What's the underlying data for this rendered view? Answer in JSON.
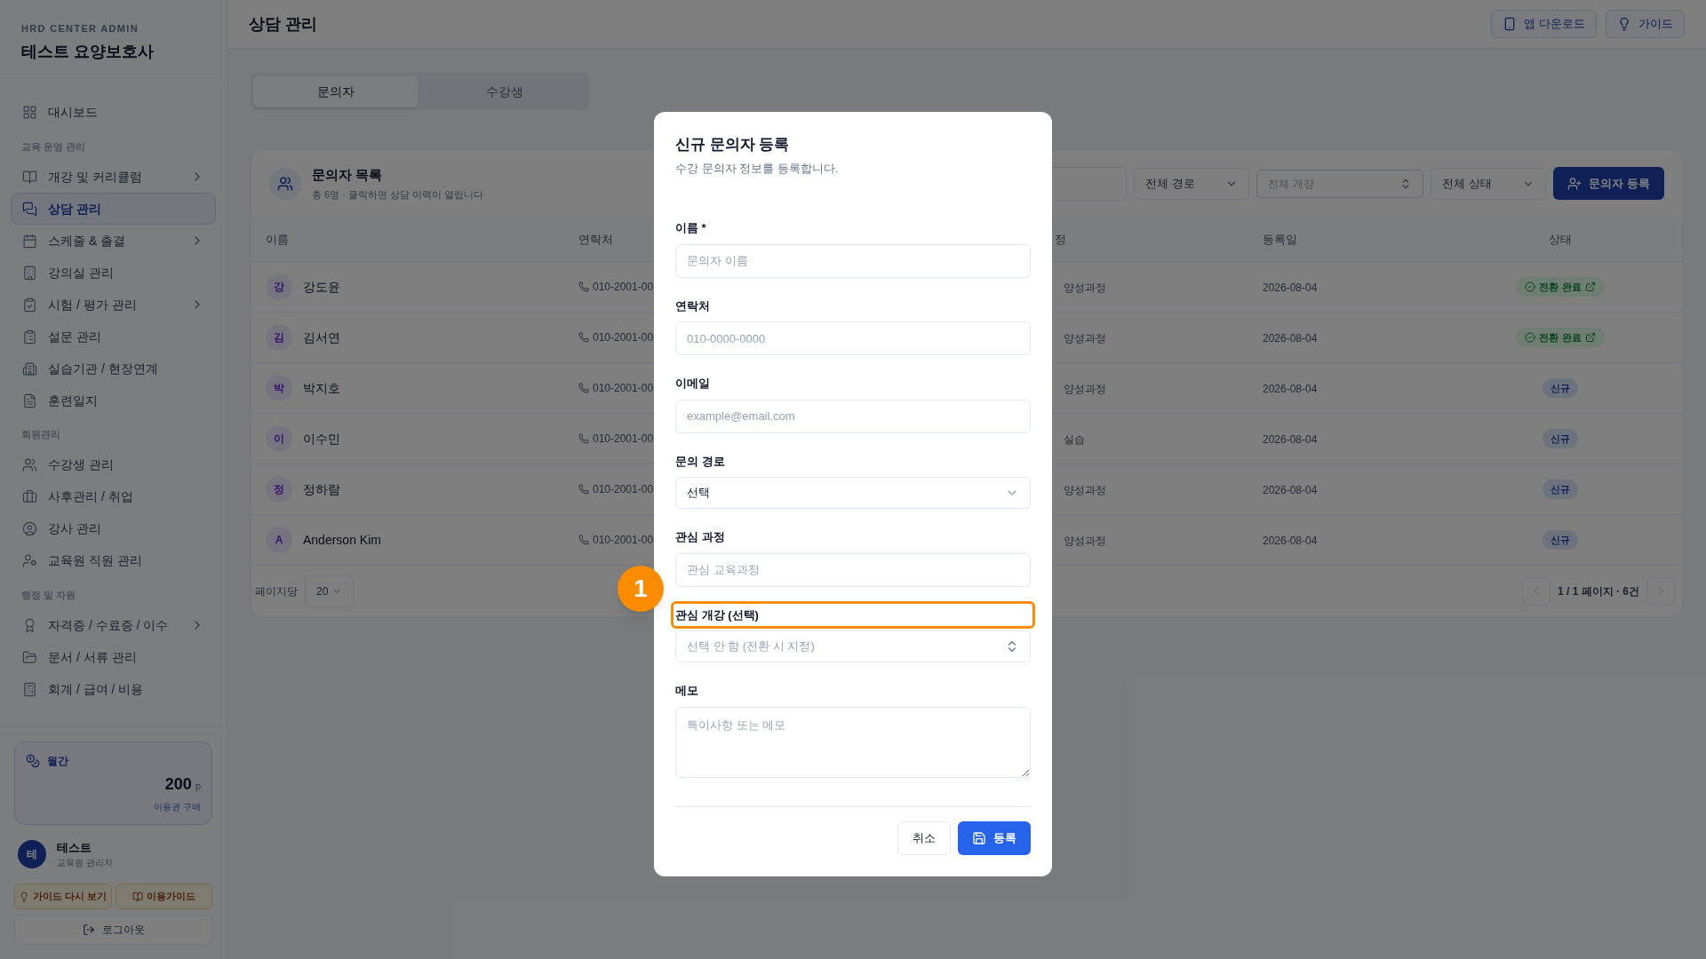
{
  "sidebar": {
    "eyebrow": "HRD CENTER ADMIN",
    "title": "테스트 요양보호사",
    "sections": [
      {
        "items": [
          {
            "label": "대시보드",
            "selected": false,
            "has_submenu": false
          }
        ]
      },
      {
        "label": "교육 운영 관리",
        "items": [
          {
            "label": "개강 및 커리큘럼",
            "selected": false,
            "has_submenu": true
          },
          {
            "label": "상담 관리",
            "selected": true,
            "has_submenu": false
          },
          {
            "label": "스케줄 & 출결",
            "selected": false,
            "has_submenu": true
          },
          {
            "label": "강의실 관리",
            "selected": false,
            "has_submenu": false
          },
          {
            "label": "시험 / 평가 관리",
            "selected": false,
            "has_submenu": true
          },
          {
            "label": "설문 관리",
            "selected": false,
            "has_submenu": false
          },
          {
            "label": "실습기관 / 현장연계",
            "selected": false,
            "has_submenu": false
          },
          {
            "label": "훈련일지",
            "selected": false,
            "has_submenu": false
          }
        ]
      },
      {
        "label": "회원관리",
        "items": [
          {
            "label": "수강생 관리",
            "selected": false,
            "has_submenu": false
          },
          {
            "label": "사후관리 / 취업",
            "selected": false,
            "has_submenu": false
          },
          {
            "label": "강사 관리",
            "selected": false,
            "has_submenu": false
          },
          {
            "label": "교육원 직원 관리",
            "selected": false,
            "has_submenu": false
          }
        ]
      },
      {
        "label": "행정 및 자원",
        "items": [
          {
            "label": "자격증 / 수료증 / 이수",
            "selected": false,
            "has_submenu": true
          },
          {
            "label": "문서 / 서류 관리",
            "selected": false,
            "has_submenu": false
          },
          {
            "label": "회계 / 급여 / 비용",
            "selected": false,
            "has_submenu": false
          }
        ]
      }
    ],
    "plan": {
      "label": "월간",
      "points": "200",
      "unit": "p",
      "link": "이용권 구매"
    },
    "user": {
      "initial": "테",
      "name": "테스트",
      "role": "교육원 관리자"
    },
    "guide_buttons": [
      "가이드 다시 보기",
      "이용가이드"
    ],
    "logout": "로그아웃"
  },
  "header": {
    "title": "상담 관리",
    "buttons": [
      "앱 다운로드",
      "가이드"
    ]
  },
  "tabs": [
    {
      "label": "문의자",
      "selected": true
    },
    {
      "label": "수강생",
      "selected": false
    }
  ],
  "card": {
    "title": "문의자 목록",
    "subtitle": "총 6명 · 클릭하면 상담 이력이 열립니다",
    "filters": [
      {
        "kind": "select",
        "value": "전체 경로"
      },
      {
        "kind": "combobox",
        "placeholder": "전체 개강"
      },
      {
        "kind": "select",
        "value": "전체 상태"
      }
    ],
    "add_button": "문의자 등록"
  },
  "table": {
    "columns": [
      "이름",
      "연락처",
      "정",
      "등록일",
      "상태"
    ],
    "rows": [
      {
        "initial": "강",
        "name": "강도윤",
        "phone": "010-2001-00",
        "course": "양성과정",
        "date": "2026-08-04",
        "status": {
          "kind": "converted",
          "label": "전환 완료"
        }
      },
      {
        "initial": "김",
        "name": "김서연",
        "phone": "010-2001-00",
        "course": "양성과정",
        "date": "2026-08-04",
        "status": {
          "kind": "converted",
          "label": "전환 완료"
        }
      },
      {
        "initial": "박",
        "name": "박지호",
        "phone": "010-2001-00",
        "course": "양성과정",
        "date": "2026-08-04",
        "status": {
          "kind": "new",
          "label": "신규"
        }
      },
      {
        "initial": "이",
        "name": "이수민",
        "phone": "010-2001-00",
        "course": "실습",
        "date": "2026-08-04",
        "status": {
          "kind": "new",
          "label": "신규"
        }
      },
      {
        "initial": "정",
        "name": "정하람",
        "phone": "010-2001-00",
        "course": "양성과정",
        "date": "2026-08-04",
        "status": {
          "kind": "new",
          "label": "신규"
        }
      },
      {
        "initial": "A",
        "name": "Anderson Kim",
        "phone": "010-2001-00",
        "course": "양성과정",
        "date": "2026-08-04",
        "status": {
          "kind": "new",
          "label": "신규"
        }
      }
    ]
  },
  "pagination": {
    "per_page_label": "페이지당",
    "per_page": "20",
    "info": "1 / 1 페이지 · 6건"
  },
  "dialog": {
    "title": "신규 문의자 등록",
    "subtitle": "수강 문의자 정보를 등록합니다.",
    "fields": [
      {
        "kind": "input",
        "label": "이름 *",
        "placeholder": "문의자 이름",
        "highlighted": false
      },
      {
        "kind": "input",
        "label": "연락처",
        "placeholder": "010-0000-0000",
        "highlighted": false
      },
      {
        "kind": "input",
        "label": "이메일",
        "placeholder": "example@email.com",
        "highlighted": false
      },
      {
        "kind": "select",
        "label": "문의 경로",
        "value": "선택",
        "highlighted": false
      },
      {
        "kind": "input",
        "label": "관심 과정",
        "placeholder": "관심 교육과정",
        "highlighted": false
      },
      {
        "kind": "combobox",
        "label": "관심 개강 (선택)",
        "placeholder": "선택 안 함 (전환 시 지정)",
        "highlighted": true
      },
      {
        "kind": "textarea",
        "label": "메모",
        "placeholder": "특이사항 또는 메모",
        "highlighted": false
      }
    ],
    "cancel": "취소",
    "submit": "등록"
  },
  "callout": {
    "number": "1"
  }
}
